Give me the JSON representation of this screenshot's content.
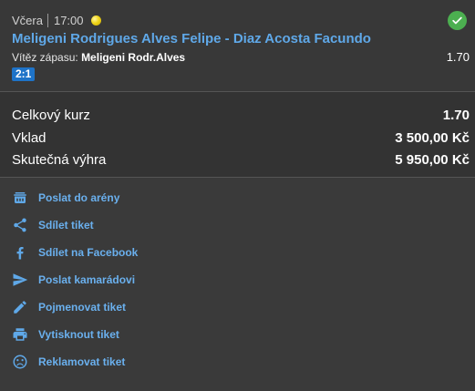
{
  "bet": {
    "day": "Včera",
    "time": "17:00",
    "sport_icon": "tennis-ball-icon",
    "status_icon": "check-circle-icon",
    "match": "Meligeni Rodrigues Alves Felipe - Diaz Acosta Facundo",
    "market_label": "Vítěz zápasu:",
    "selection": "Meligeni Rodr.Alves",
    "odds": "1.70",
    "score": "2:1"
  },
  "summary": {
    "rows": [
      {
        "label": "Celkový kurz",
        "value": "1.70"
      },
      {
        "label": "Vklad",
        "value": "3 500,00 Kč"
      },
      {
        "label": "Skutečná výhra",
        "value": "5 950,00 Kč"
      }
    ]
  },
  "actions": [
    {
      "icon": "arena-icon",
      "label": "Poslat do arény"
    },
    {
      "icon": "share-icon",
      "label": "Sdílet tiket"
    },
    {
      "icon": "facebook-icon",
      "label": "Sdílet na Facebook"
    },
    {
      "icon": "send-icon",
      "label": "Poslat kamarádovi"
    },
    {
      "icon": "pencil-icon",
      "label": "Pojmenovat tiket"
    },
    {
      "icon": "printer-icon",
      "label": "Vytisknout tiket"
    },
    {
      "icon": "sad-face-icon",
      "label": "Reklamovat tiket"
    }
  ],
  "colors": {
    "accent": "#5fa8e8",
    "success": "#4caf50",
    "score_badge": "#1e73c8",
    "background": "#3a3a3a"
  }
}
